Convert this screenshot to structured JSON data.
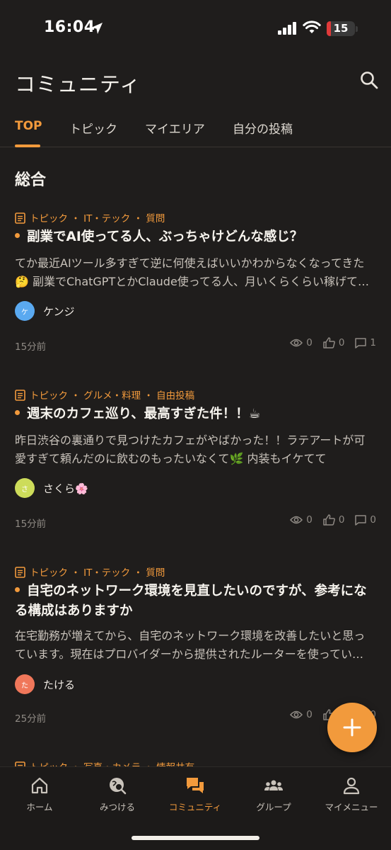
{
  "status_bar": {
    "time": "16:04",
    "battery": "15",
    "battery_level": 0.15
  },
  "header": {
    "title": "コミュニティ",
    "search_icon": "search-icon"
  },
  "tabs": [
    {
      "label": "TOP",
      "active": true
    },
    {
      "label": "トピック",
      "active": false
    },
    {
      "label": "マイエリア",
      "active": false
    },
    {
      "label": "自分の投稿",
      "active": false
    }
  ],
  "section_title": "総合",
  "posts": [
    {
      "category": "トピック ・ IT・テック ・ 質問",
      "title": "副業でAI使ってる人、ぶっちゃけどんな感じ？",
      "body": "てか最近AIツール多すぎて逆に何使えばいいかわからなくなってきた🤔 副業でChatGPTとかClaude使ってる人、月いくらくらい稼げてる？",
      "author": "ケンジ",
      "avatar_initial": "ケ",
      "avatar_color": "#5aa9f0",
      "time": "15分前",
      "views": "0",
      "likes": "0",
      "comments": "1"
    },
    {
      "category": "トピック ・ グルメ・料理 ・ 自由投稿",
      "title": "週末のカフェ巡り、最高すぎた件！！☕",
      "body": "昨日渋谷の裏通りで見つけたカフェがやばかった！！ラテアートが可愛すぎて頼んだのに飲むのもったいなくて🌿 内装もイケてて",
      "author": "さくら🌸",
      "avatar_initial": "さ",
      "avatar_color": "#cddc5a",
      "time": "15分前",
      "views": "0",
      "likes": "0",
      "comments": "0"
    },
    {
      "category": "トピック ・ IT・テック ・ 質問",
      "title": "自宅のネットワーク環境を見直したいのですが、参考になる構成はありますか",
      "body": "在宅勤務が増えてから、自宅のネットワーク環境を改善したいと思っています。現在はプロバイダーから提供されたルーターを使っています。",
      "author": "たける",
      "avatar_initial": "た",
      "avatar_color": "#f0775a",
      "time": "25分前",
      "views": "0",
      "likes": "0",
      "comments": "0"
    },
    {
      "category": "トピック ・ 写真・カメラ ・ 情報共有"
    }
  ],
  "fab": {
    "icon": "plus-icon"
  },
  "bottom_nav": [
    {
      "label": "ホーム",
      "icon": "home-icon",
      "active": false
    },
    {
      "label": "みつける",
      "icon": "explore-icon",
      "active": false
    },
    {
      "label": "コミュニティ",
      "icon": "chat-bubbles-icon",
      "active": true
    },
    {
      "label": "グループ",
      "icon": "group-icon",
      "active": false
    },
    {
      "label": "マイメニュー",
      "icon": "person-icon",
      "active": false
    }
  ],
  "colors": {
    "accent": "#f29a3c",
    "background": "#1f1d1c"
  }
}
